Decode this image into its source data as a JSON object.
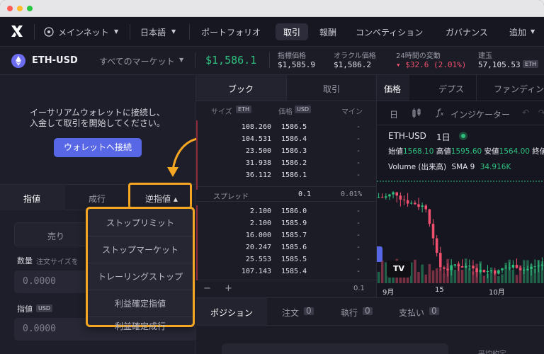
{
  "nav": {
    "network": "メインネット",
    "language": "日本語",
    "items": [
      "ポートフォリオ",
      "取引",
      "報酬",
      "コンペティション",
      "ガバナンス",
      "追加"
    ]
  },
  "market": {
    "pair": "ETH-USD",
    "all_markets": "すべてのマーケット",
    "price": "$1,586.1",
    "stats": [
      {
        "label": "指標価格",
        "value": "$1,585.9"
      },
      {
        "label": "オラクル価格",
        "value": "$1,586.2"
      },
      {
        "label": "24時間の変動",
        "value": "▾ $32.6 (2.01%)"
      },
      {
        "label": "建玉",
        "value": "57,105.53",
        "unit": "ETH"
      }
    ]
  },
  "left": {
    "connect_msg_1": "イーサリアムウォレットに接続し、",
    "connect_msg_2": "入金して取引を開始してください。",
    "connect_button": "ウォレットへ接続",
    "order_tabs": [
      "指値",
      "成行",
      "逆指値 ▴"
    ],
    "sell": "売り",
    "qty_label": "数量",
    "qty_hint": "注文サイズを",
    "qty_value": "0.0000",
    "limit_label": "指値",
    "limit_unit": "USD",
    "limit_value": "0.0000",
    "dropdown": [
      "ストップリミット",
      "ストップマーケット",
      "トレーリングストップ",
      "利益確定指値",
      "利益確定成行"
    ]
  },
  "orderbook": {
    "tabs": [
      "ブック",
      "取引"
    ],
    "headers": {
      "size": "サイズ",
      "size_unit": "ETH",
      "price": "価格",
      "price_unit": "USD",
      "mine": "マイン"
    },
    "asks": [
      {
        "size": "108.260",
        "price": "1586.5",
        "mine": "-"
      },
      {
        "size": "104.531",
        "price": "1586.4",
        "mine": "-"
      },
      {
        "size": "23.500",
        "price": "1586.3",
        "mine": "-"
      },
      {
        "size": "31.938",
        "price": "1586.2",
        "mine": "-"
      },
      {
        "size": "36.112",
        "price": "1586.1",
        "mine": "-"
      }
    ],
    "spread_label": "スプレッド",
    "spread_value": "0.1",
    "spread_pct": "0.01%",
    "bids": [
      {
        "size": "2.100",
        "price": "1586.0",
        "mine": "-"
      },
      {
        "size": "2.100",
        "price": "1585.9",
        "mine": "-"
      },
      {
        "size": "16.000",
        "price": "1585.7",
        "mine": "-"
      },
      {
        "size": "20.247",
        "price": "1585.6",
        "mine": "-"
      },
      {
        "size": "25.553",
        "price": "1585.5",
        "mine": "-"
      },
      {
        "size": "107.143",
        "price": "1585.4",
        "mine": "-"
      }
    ],
    "minus": "−",
    "plus": "+",
    "step": "0.1"
  },
  "chart": {
    "tabs": [
      "価格",
      "デプス",
      "ファンディン"
    ],
    "toolbar_day": "日",
    "indicators": "インジケーター",
    "symbol": "ETH-USD",
    "interval": "1日",
    "ohlc": [
      {
        "label": "始値",
        "value": "1568.10"
      },
      {
        "label": "高値",
        "value": "1595.60"
      },
      {
        "label": "安値",
        "value": "1564.00"
      },
      {
        "label": "終値",
        "value": ""
      }
    ],
    "volume_label": "Volume (出来高)",
    "sma_label": "SMA 9",
    "sma_value": "34.916K",
    "x_ticks": [
      "9月",
      "15",
      "10月"
    ],
    "tv_logo": "TV"
  },
  "positions": {
    "tabs": [
      {
        "label": "ポジション",
        "count": ""
      },
      {
        "label": "注文",
        "count": "0"
      },
      {
        "label": "執行",
        "count": "0"
      },
      {
        "label": "支払い",
        "count": "0"
      }
    ],
    "avg_label": "平均約定"
  },
  "colors": {
    "accent": "#5867e6",
    "up": "#2fc07e",
    "down": "#f0506e",
    "highlight": "#f5a623"
  }
}
